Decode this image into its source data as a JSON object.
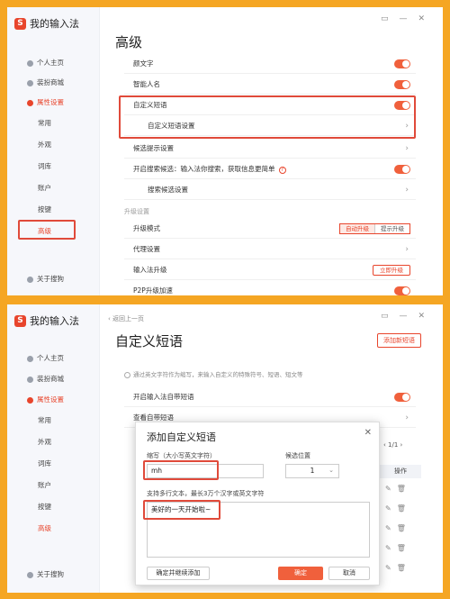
{
  "top": {
    "brand": "我的输入法",
    "window_controls": [
      "▭",
      "—",
      "✕"
    ],
    "sidebar": [
      "个人主页",
      "装扮商城",
      "属性设置",
      "常用",
      "外观",
      "词库",
      "账户",
      "按键",
      "高级"
    ],
    "about": "关于搜狗",
    "title": "高级",
    "rows": [
      {
        "label": "颜文字"
      },
      {
        "label": "智能人名"
      },
      {
        "label": "自定义短语"
      },
      {
        "label": "自定义短语设置"
      },
      {
        "label": "候选提示设置"
      },
      {
        "label": "开启搜索候选：输入法你搜索，获取信息更简单"
      },
      {
        "label": "搜索候选设置"
      }
    ],
    "section": "升级设置",
    "upgrade_rows": [
      {
        "label": "升级模式",
        "opt1": "自动升级",
        "opt2": "提示升级"
      },
      {
        "label": "代理设置"
      },
      {
        "label": "输入法升级",
        "button": "立即升级"
      },
      {
        "label": "P2P升级加速"
      }
    ]
  },
  "bottom": {
    "brand": "我的输入法",
    "back": "返回上一页",
    "window_controls": [
      "▭",
      "—",
      "✕"
    ],
    "sidebar": [
      "个人主页",
      "装扮商城",
      "属性设置",
      "常用",
      "外观",
      "词库",
      "账户",
      "按键",
      "高级"
    ],
    "about": "关于搜狗",
    "title": "自定义短语",
    "add_button": "添加新短语",
    "hint": "通过英文字符作为缩写，来输入自定义的特殊符号、短语、短文等",
    "row1": "开启输入法自带短语",
    "row2": "查看自带短语",
    "pager": "1/1",
    "ops_header": "操作",
    "dialog": {
      "title": "添加自定义短语",
      "abbr_label": "缩写（大小写英文字符）",
      "abbr_value": "mh",
      "pos_label": "候选位置",
      "pos_value": "1",
      "text_label": "支持多行文本，最长3万个汉字或英文字符",
      "text_value": "美好的一天开始啦~",
      "btn_continue": "确定并继续添加",
      "btn_ok": "确定",
      "btn_cancel": "取消"
    }
  },
  "accent": "#e8452c"
}
